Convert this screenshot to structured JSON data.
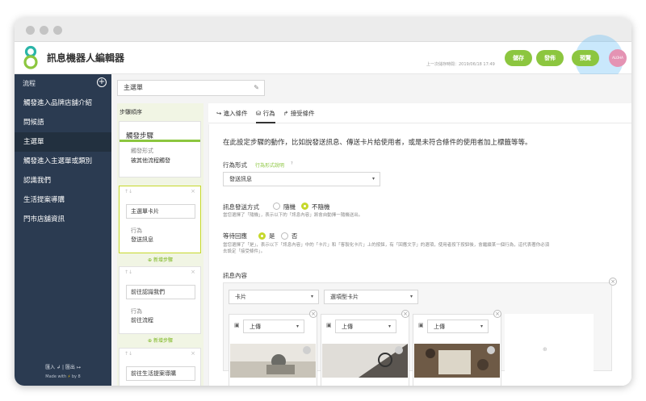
{
  "app": {
    "title": "訊息機器人編輯器",
    "last_saved": "上一次儲存時間：2019/06/18 17:49",
    "buttons": {
      "save": "儲存",
      "publish": "發佈",
      "preview": "預覽"
    },
    "avatar_text": "ALOHA",
    "colors": {
      "accent": "#8cc63f",
      "sidebar": "#2b3b51",
      "steps_bg": "#f1f5e4",
      "avatar": "#e493b3"
    }
  },
  "sidebar": {
    "header": "流程",
    "items": [
      {
        "label": "觸發進入品牌店舖介紹"
      },
      {
        "label": "問候語"
      },
      {
        "label": "主選單"
      },
      {
        "label": "觸發進入主選單或類別"
      },
      {
        "label": "認識我們"
      },
      {
        "label": "生活提案導購"
      },
      {
        "label": "門市店舖資訊"
      }
    ],
    "import_label": "匯入",
    "export_label": "匯出",
    "made_with": "Made with",
    "by_label": "by 8"
  },
  "flow_name": "主選單",
  "steps": {
    "header": "步驟順序",
    "trigger": {
      "title": "觸發步驟",
      "type_label": "觸發形式",
      "type_value": "被其他流程觸發"
    },
    "cards": [
      {
        "name": "主選單卡片",
        "action_label": "行為",
        "action_value": "發送訊息"
      },
      {
        "name": "前往認識我們",
        "action_label": "行為",
        "action_value": "前往流程"
      },
      {
        "name": "前往生活提案導購"
      }
    ],
    "add_step": "新增步驟"
  },
  "tabs": [
    {
      "label": "進入條件"
    },
    {
      "label": "行為"
    },
    {
      "label": "接受條件"
    }
  ],
  "editor": {
    "description": "在此設定步驟的動作，比如說發送訊息、傳送卡片給使用者，或是未符合條件的使用者加上標籤等等。",
    "behavior_label": "行為形式",
    "behavior_help": "行為形式說明",
    "behavior_value": "發送訊息",
    "send_mode_label": "訊息發送方式",
    "send_mode_options": [
      "隨機",
      "不隨機"
    ],
    "send_mode_selected": "不隨機",
    "send_mode_hint": "當您選擇了「隨機」，表示以下的「訊息內容」將會自動擇一隨機送出。",
    "wait_label": "等待回應",
    "wait_options": [
      "是",
      "否"
    ],
    "wait_selected": "是",
    "wait_hint_1": "當您選擇了「是」，表示以下「訊息內容」中的「卡片」和「客製化卡片」上的按鈕，有「回應文字」的選項，使用者按下按鈕後，會繼續某一個行為，這代表著你必須",
    "wait_hint_2": "去設定「接受條件」。",
    "content_label": "訊息內容",
    "content_type": "卡片",
    "card_type": "選項型卡片",
    "upload_label": "上傳"
  }
}
